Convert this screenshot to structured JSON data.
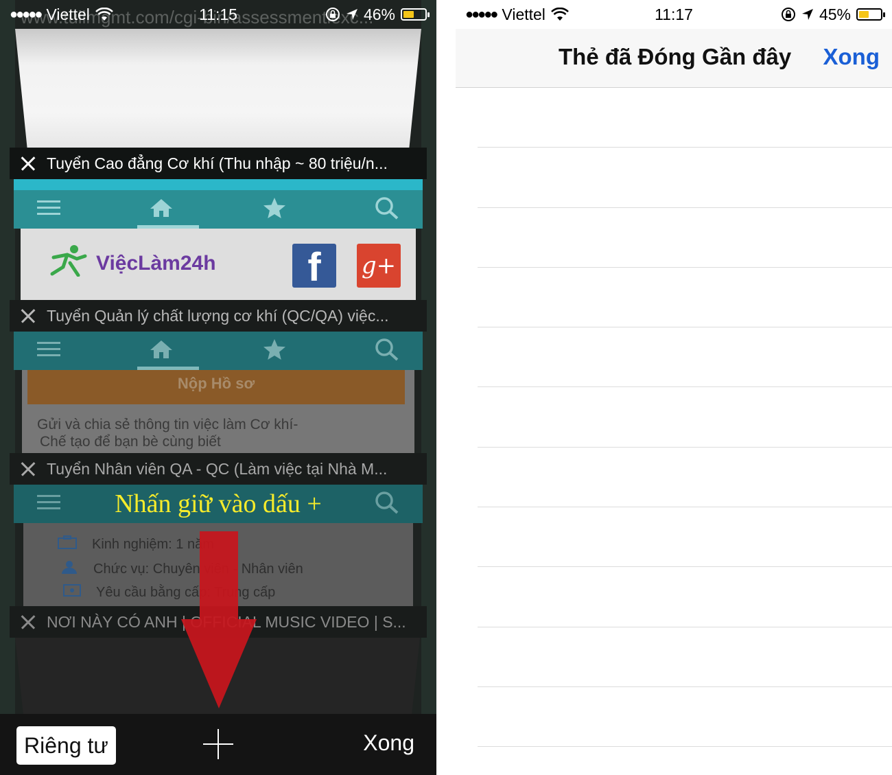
{
  "left": {
    "status": {
      "carrier": "Viettel",
      "time": "11:15",
      "battery_percent": "46%",
      "battery_level": 0.46
    },
    "url_ghost": "www.tuilmgmt.com/cgi-bin/assessmentlexc...",
    "tabs": [
      {
        "title": "Tuyển Cao đẳng Cơ khí (Thu nhập ~ 80 triệu/n..."
      },
      {
        "title": "Tuyển Quản lý chất lượng cơ khí (QC/QA) việc..."
      },
      {
        "title": "Tuyển Nhân viên QA - QC (Làm việc tại Nhà M..."
      },
      {
        "title": "NƠI NÀY CÓ ANH | OFFICIAL MUSIC VIDEO | S..."
      }
    ],
    "page1": {
      "logo_text": "ViệcLàm24h",
      "fb_label": "f",
      "gplus_label": "g+"
    },
    "page2": {
      "button_text": "Nộp Hồ sơ",
      "share_text_line1": "Gửi và chia sẻ thông tin việc làm Cơ khí-",
      "share_text_line2": "Chế tạo để bạn bè cùng biết"
    },
    "page3": {
      "items": [
        "Kinh nghiệm: 1 năm",
        "Chức vụ: Chuyên viên - Nhân viên",
        "Yêu cầu bằng cấp: Trung cấp"
      ]
    },
    "annotation": "Nhấn giữ vào dấu +",
    "toolbar": {
      "private_label": "Riêng tư",
      "done_label": "Xong"
    },
    "colors": {
      "teal": "#2b8f94",
      "annotation": "#f7ec2b",
      "arrow": "#c8161d"
    }
  },
  "right": {
    "status": {
      "carrier": "Viettel",
      "time": "11:17",
      "battery_percent": "45%",
      "battery_level": 0.45
    },
    "title": "Thẻ đã Đóng Gần đây",
    "done_label": "Xong",
    "colors": {
      "link": "#1a5fd6"
    }
  }
}
